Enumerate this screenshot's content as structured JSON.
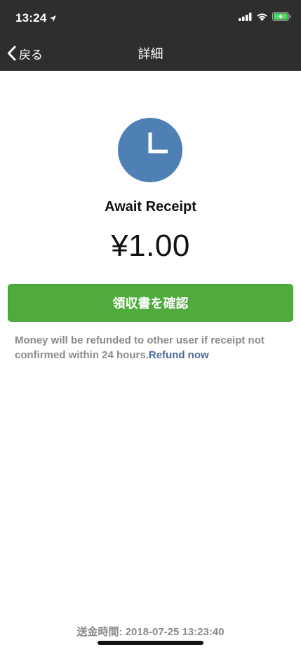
{
  "status_bar": {
    "time": "13:24",
    "icons": [
      "location-arrow-icon",
      "cellular-signal-icon",
      "wifi-icon",
      "battery-charging-icon"
    ]
  },
  "nav": {
    "back_label": "戻る",
    "title": "詳細"
  },
  "transfer": {
    "icon": "clock-icon",
    "status": "Await Receipt",
    "amount": "¥1.00",
    "confirm_button": "領収書を確認",
    "notice_text": "Money will be refunded to other user if receipt not confirmed within 24 hours.",
    "refund_link": "Refund now",
    "send_time": "送金時間: 2018-07-25 13:23:40"
  },
  "colors": {
    "bar_background": "#2e2e2e",
    "clock_circle": "#4e7fb5",
    "button_green": "#4fab3b",
    "link_blue": "#4a6a9a",
    "secondary_text": "#8a8a8a"
  }
}
